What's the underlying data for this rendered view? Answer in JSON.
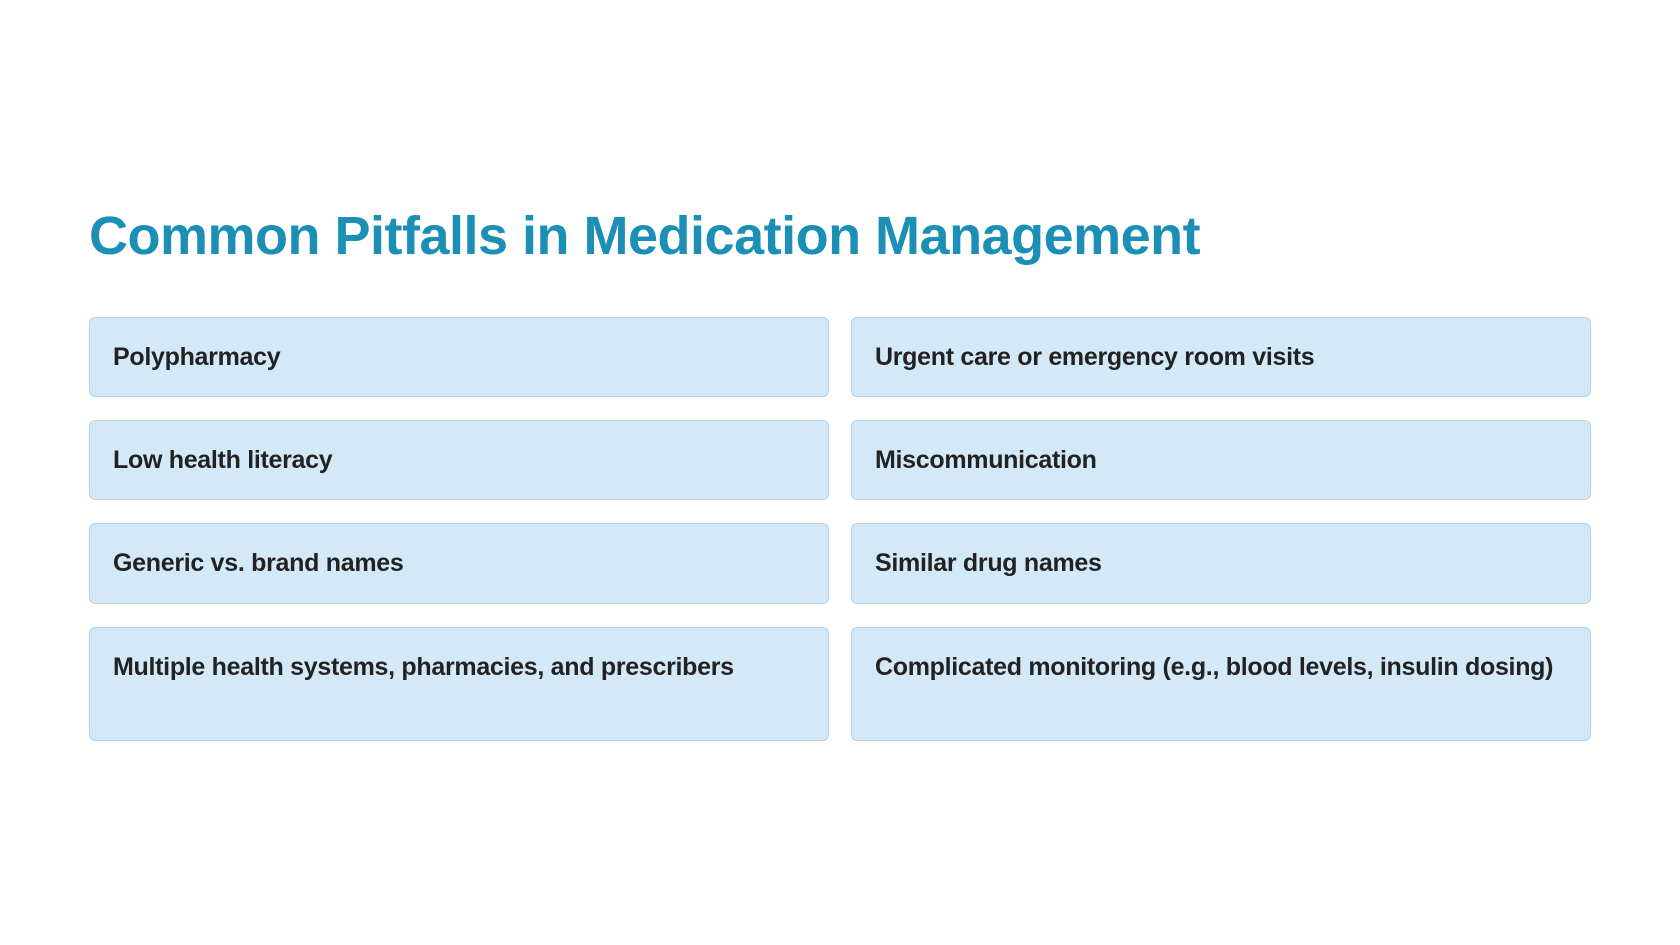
{
  "title": "Common Pitfalls in Medication Management",
  "items": [
    "Polypharmacy",
    "Urgent care or emergency room visits",
    "Low health literacy",
    "Miscommunication",
    "Generic vs. brand names",
    "Similar drug names",
    "Multiple health systems, pharmacies, and prescribers",
    "Complicated monitoring (e.g., blood levels, insulin dosing)"
  ],
  "colors": {
    "title": "#1b8fb5",
    "card_bg": "#d4e9f7",
    "card_border": "#b5d2e6",
    "text": "#222222"
  }
}
